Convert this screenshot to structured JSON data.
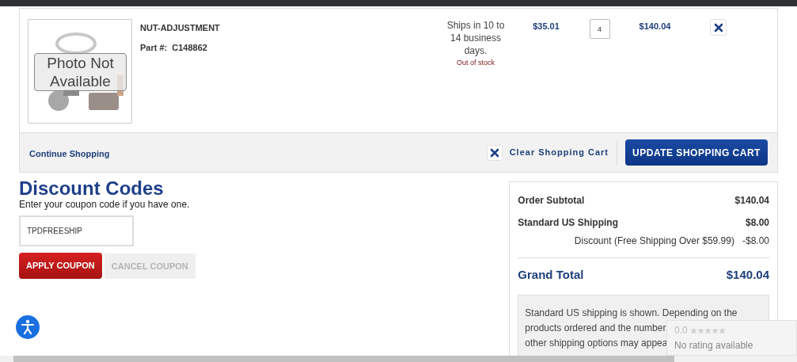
{
  "cart_item": {
    "photo_label": "Photo Not Available",
    "name": "NUT-ADJUSTMENT",
    "part_label": "Part #:",
    "part_number": "C148862",
    "shipping": "Ships in 10 to 14 business days.",
    "stock": "Out of stock",
    "price": "$35.01",
    "quantity": "4",
    "total": "$140.04"
  },
  "cart_actions": {
    "continue": "Continue Shopping",
    "clear": "Clear Shopping Cart",
    "update": "UPDATE SHOPPING CART"
  },
  "discount": {
    "title": "Discount Codes",
    "hint": "Enter your coupon code if you have one.",
    "code": "TPDFREESHIP",
    "buttons": [
      {
        "label": "APPLY COUPON",
        "disabled": false
      },
      {
        "label": "CANCEL COUPON",
        "disabled": true
      }
    ]
  },
  "summary": {
    "rows": [
      {
        "label": "Order Subtotal",
        "value": "$140.04",
        "kind": "bold"
      },
      {
        "label": "Standard US Shipping",
        "value": "$8.00",
        "kind": "bold"
      },
      {
        "label": "Discount (Free Shipping Over $59.99)",
        "value": "-$8.00",
        "kind": "sub"
      }
    ],
    "grand_total": {
      "label": "Grand Total",
      "value": "$140.04"
    },
    "note_lines": [
      "Standard US shipping is shown. Depending on the",
      "products ordered and the number",
      "other shipping options may appea"
    ]
  },
  "rating": {
    "score": "0.0",
    "stars": 0,
    "text": "No rating available"
  }
}
